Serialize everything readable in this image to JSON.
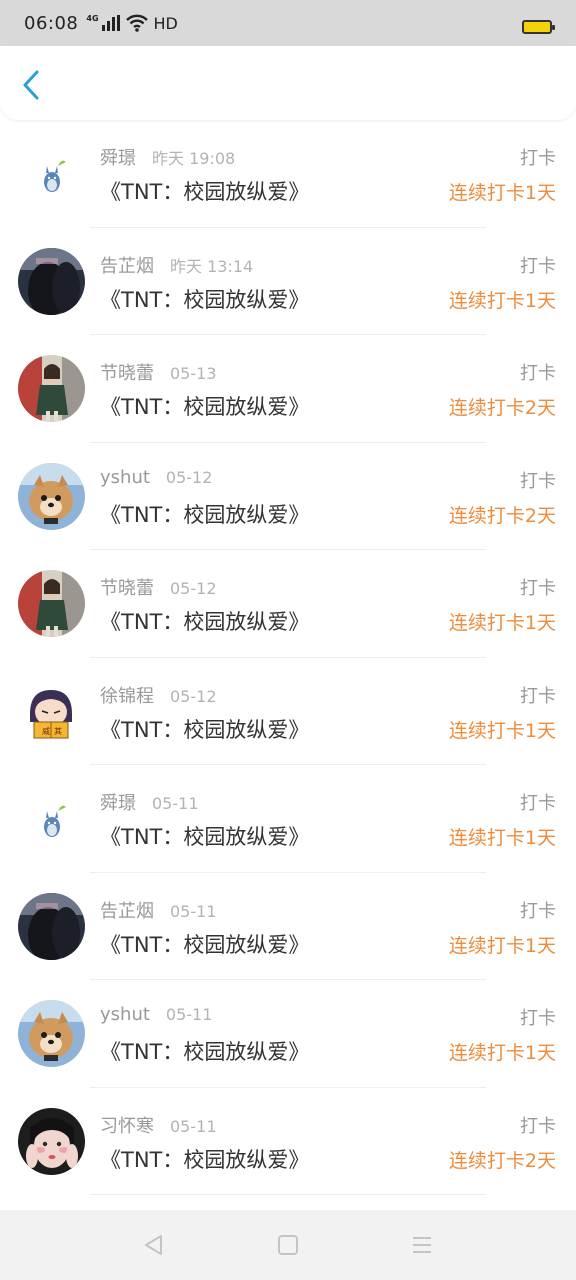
{
  "status_bar": {
    "time": "06:08",
    "network": "4G",
    "hd": "HD",
    "icons": [
      "signal-icon",
      "wifi-icon",
      "battery-icon"
    ]
  },
  "header": {
    "back_icon": "chevron-left-icon",
    "accent_color": "#2a9fd8"
  },
  "colors": {
    "streak": "#ef8c3b",
    "muted": "#999999",
    "title": "#333333"
  },
  "entries": [
    {
      "user": "舜璟",
      "time": "昨天 19:08",
      "book": "《TNT：校园放纵爱》",
      "action": "打卡",
      "streak": "连续打卡1天",
      "avatar": "totoro"
    },
    {
      "user": "告芷烟",
      "time": "昨天 13:14",
      "book": "《TNT：校园放纵爱》",
      "action": "打卡",
      "streak": "连续打卡1天",
      "avatar": "dark-girl"
    },
    {
      "user": "节晓蕾",
      "time": "05-13",
      "book": "《TNT：校园放纵爱》",
      "action": "打卡",
      "streak": "连续打卡2天",
      "avatar": "street-girl"
    },
    {
      "user": "yshut",
      "time": "05-12",
      "book": "《TNT：校园放纵爱》",
      "action": "打卡",
      "streak": "连续打卡2天",
      "avatar": "pomeranian"
    },
    {
      "user": "节晓蕾",
      "time": "05-12",
      "book": "《TNT：校园放纵爱》",
      "action": "打卡",
      "streak": "连续打卡1天",
      "avatar": "street-girl"
    },
    {
      "user": "徐锦程",
      "time": "05-12",
      "book": "《TNT：校园放纵爱》",
      "action": "打卡",
      "streak": "连续打卡1天",
      "avatar": "cartoon-reader"
    },
    {
      "user": "舜璟",
      "time": "05-11",
      "book": "《TNT：校园放纵爱》",
      "action": "打卡",
      "streak": "连续打卡1天",
      "avatar": "totoro"
    },
    {
      "user": "告芷烟",
      "time": "05-11",
      "book": "《TNT：校园放纵爱》",
      "action": "打卡",
      "streak": "连续打卡1天",
      "avatar": "dark-girl"
    },
    {
      "user": "yshut",
      "time": "05-11",
      "book": "《TNT：校园放纵爱》",
      "action": "打卡",
      "streak": "连续打卡1天",
      "avatar": "pomeranian"
    },
    {
      "user": "习怀寒",
      "time": "05-11",
      "book": "《TNT：校园放纵爱》",
      "action": "打卡",
      "streak": "连续打卡2天",
      "avatar": "face-girl"
    }
  ],
  "nav": {
    "icons": [
      "back-triangle-icon",
      "home-square-icon",
      "menu-lines-icon"
    ]
  }
}
